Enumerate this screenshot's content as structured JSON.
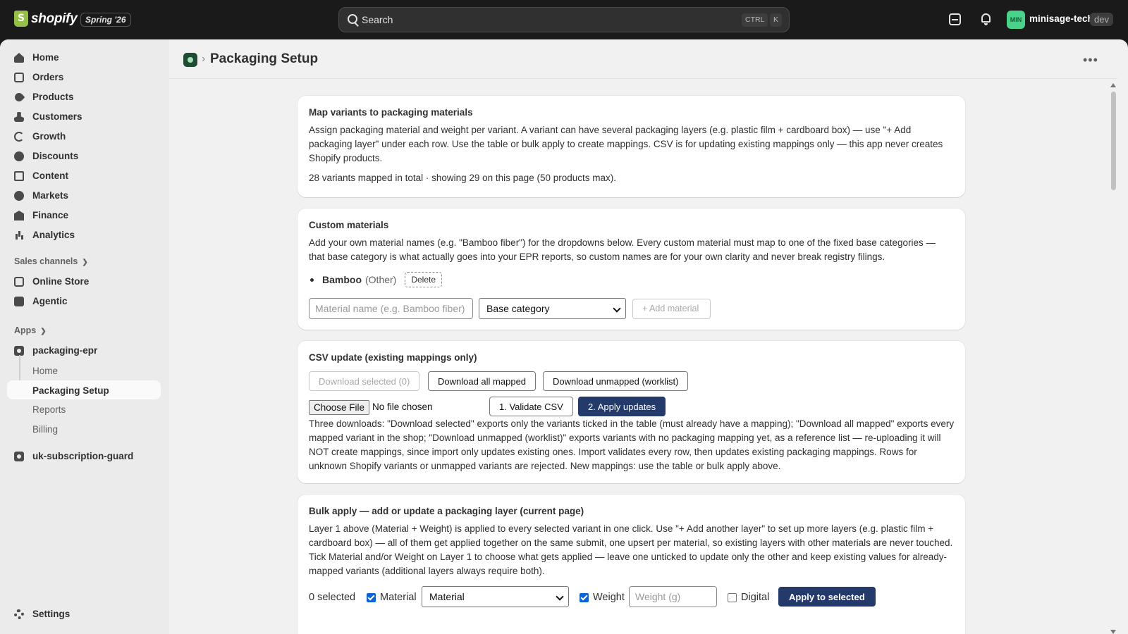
{
  "topbar": {
    "brand": "shopify",
    "edition": "Spring '26",
    "search_placeholder": "Search",
    "shortcut_ctrl": "CTRL",
    "shortcut_key": "K",
    "avatar_initials": "MIN",
    "store_name": "minisage-tech",
    "env_badge": "dev"
  },
  "sidebar": {
    "items": [
      {
        "label": "Home",
        "icon": "home-icon"
      },
      {
        "label": "Orders",
        "icon": "orders-icon"
      },
      {
        "label": "Products",
        "icon": "tag-icon"
      },
      {
        "label": "Customers",
        "icon": "person-icon"
      },
      {
        "label": "Growth",
        "icon": "growth-icon"
      },
      {
        "label": "Discounts",
        "icon": "discount-icon"
      },
      {
        "label": "Content",
        "icon": "content-icon"
      },
      {
        "label": "Markets",
        "icon": "globe-icon"
      },
      {
        "label": "Finance",
        "icon": "bank-icon"
      },
      {
        "label": "Analytics",
        "icon": "bar-chart-icon"
      }
    ],
    "sales_channels_label": "Sales channels",
    "channels": [
      {
        "label": "Online Store",
        "icon": "store-icon"
      },
      {
        "label": "Agentic",
        "icon": "agentic-icon"
      }
    ],
    "apps_label": "Apps",
    "app_name": "packaging-epr",
    "app_subitems": [
      "Home",
      "Packaging Setup",
      "Reports",
      "Billing"
    ],
    "app2_name": "uk-subscription-guard",
    "settings_label": "Settings"
  },
  "page": {
    "title": "Packaging Setup"
  },
  "map_card": {
    "title": "Map variants to packaging materials",
    "description": "Assign packaging material and weight per variant. A variant can have several packaging layers (e.g. plastic film + cardboard box) — use \"+ Add packaging layer\" under each row. Use the table or bulk apply to create mappings. CSV is for updating existing mappings only — this app never creates Shopify products.",
    "summary": "28 variants mapped in total · showing 29 on this page (50 products max)."
  },
  "custom_card": {
    "title": "Custom materials",
    "description": "Add your own material names (e.g. \"Bamboo fiber\") for the dropdowns below. Every custom material must map to one of the fixed base categories — that base category is what actually goes into your EPR reports, so custom names are for your own clarity and never break registry filings.",
    "materials": [
      {
        "name": "Bamboo",
        "category": "(Other)"
      }
    ],
    "delete_label": "Delete",
    "name_placeholder": "Material name (e.g. Bamboo fiber)",
    "category_value": "Base category",
    "add_label": "+ Add material"
  },
  "csv_card": {
    "title": "CSV update (existing mappings only)",
    "download_selected": "Download selected (0)",
    "download_all": "Download all mapped",
    "download_unmapped": "Download unmapped (worklist)",
    "choose_file": "Choose File",
    "no_file": "No file chosen",
    "validate": "1. Validate CSV",
    "apply": "2. Apply updates",
    "description": "Three downloads: \"Download selected\" exports only the variants ticked in the table (must already have a mapping); \"Download all mapped\" exports every mapped variant in the shop; \"Download unmapped (worklist)\" exports variants with no packaging mapping yet, as a reference list — re-uploading it will NOT create mappings, since import only updates existing ones. Import validates every row, then updates existing packaging mappings. Rows for unknown Shopify variants or unmapped variants are rejected. New mappings: use the table or bulk apply above."
  },
  "bulk_card": {
    "title": "Bulk apply — add or update a packaging layer (current page)",
    "description": "Layer 1 above (Material + Weight) is applied to every selected variant in one click. Use \"+ Add another layer\" to set up more layers (e.g. plastic film + cardboard box) — all of them get applied together on the same submit, one upsert per material, so existing layers with other materials are never touched. Tick Material and/or Weight on Layer 1 to choose what gets applied — leave one unticked to update only the other and keep existing values for already-mapped variants (additional layers always require both).",
    "selected_count": "0 selected",
    "material_label": "Material",
    "material_checked": true,
    "material_value": "Material",
    "weight_label": "Weight",
    "weight_checked": true,
    "weight_placeholder": "Weight (g)",
    "digital_label": "Digital",
    "digital_checked": false,
    "apply_label": "Apply to selected"
  }
}
